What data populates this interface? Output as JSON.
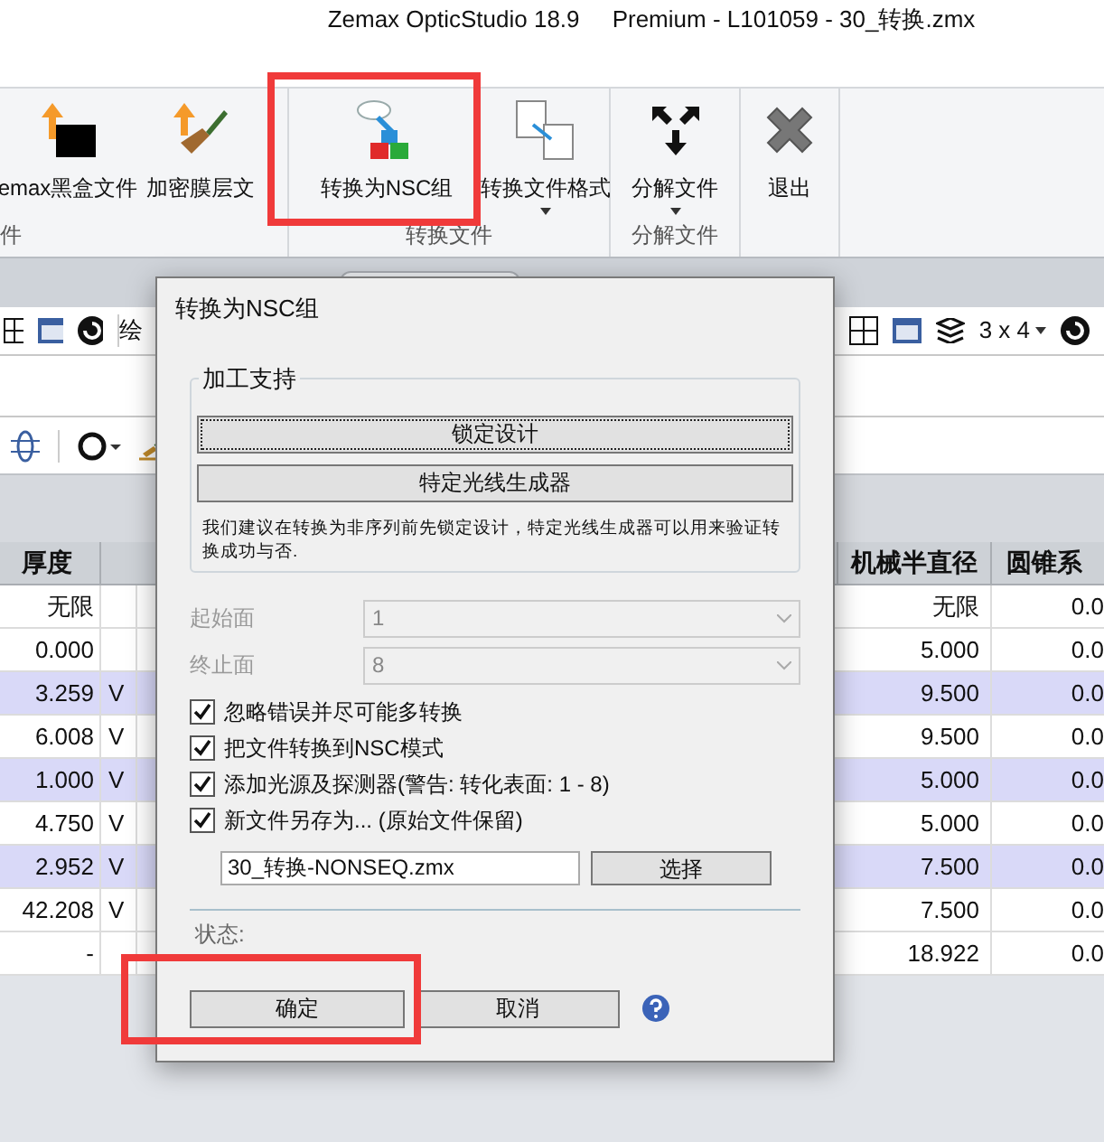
{
  "window": {
    "title": "Zemax OpticStudio 18.9     Premium - L101059 - 30_转换.zmx"
  },
  "ribbon": {
    "groups": [
      {
        "label": "件",
        "buttons": [
          {
            "kind": "blackbox",
            "label": "emax黑盒文件",
            "dropdown": false
          },
          {
            "kind": "coating",
            "label": "加密膜层文",
            "dropdown": false
          }
        ]
      },
      {
        "label": "转换文件",
        "buttons": [
          {
            "kind": "nsc",
            "label": "转换为NSC组",
            "dropdown": false
          },
          {
            "kind": "format",
            "label": "转换文件格式",
            "dropdown": true
          }
        ]
      },
      {
        "label": "分解文件",
        "buttons": [
          {
            "kind": "split",
            "label": "分解文件",
            "dropdown": true
          }
        ]
      },
      {
        "buttons": [
          {
            "kind": "exit",
            "label": "退出",
            "dropdown": false
          }
        ]
      }
    ]
  },
  "toolbar": {
    "left_label": "绘",
    "layout": "3 x 4"
  },
  "table": {
    "columns": [
      "厚度",
      "机械半直径",
      "圆锥系"
    ],
    "rows": [
      {
        "thickness": "无限",
        "solve": "",
        "semi_diameter": "无限",
        "conic": "0.0",
        "highlighted": false
      },
      {
        "thickness": "0.000",
        "solve": "",
        "semi_diameter": "5.000",
        "conic": "0.0",
        "highlighted": false
      },
      {
        "thickness": "3.259",
        "solve": "V",
        "semi_diameter": "9.500",
        "conic": "0.0",
        "highlighted": true
      },
      {
        "thickness": "6.008",
        "solve": "V",
        "semi_diameter": "9.500",
        "conic": "0.0",
        "highlighted": false
      },
      {
        "thickness": "1.000",
        "solve": "V",
        "semi_diameter": "5.000",
        "conic": "0.0",
        "highlighted": true
      },
      {
        "thickness": "4.750",
        "solve": "V",
        "semi_diameter": "5.000",
        "conic": "0.0",
        "highlighted": false
      },
      {
        "thickness": "2.952",
        "solve": "V",
        "semi_diameter": "7.500",
        "conic": "0.0",
        "highlighted": true
      },
      {
        "thickness": "42.208",
        "solve": "V",
        "semi_diameter": "7.500",
        "conic": "0.0",
        "highlighted": false
      },
      {
        "thickness": "-",
        "solve": "",
        "semi_diameter": "18.922",
        "conic": "0.0",
        "highlighted": false
      }
    ]
  },
  "dialog": {
    "title": "转换为NSC组",
    "group_title": "加工支持",
    "support_buttons": [
      {
        "label": "锁定设计",
        "focused": true
      },
      {
        "label": "特定光线生成器",
        "focused": false
      }
    ],
    "note": "我们建议在转换为非序列前先锁定设计，特定光线生成器可以用来验证转换成功与否.",
    "selects": [
      {
        "label": "起始面",
        "value": "1",
        "disabled": true
      },
      {
        "label": "终止面",
        "value": "8",
        "disabled": true
      }
    ],
    "options": [
      {
        "label": "忽略错误并尽可能多转换",
        "checked": true
      },
      {
        "label": "把文件转换到NSC模式",
        "checked": true
      },
      {
        "label": "添加光源及探测器(警告: 转化表面: 1 - 8)",
        "checked": true
      },
      {
        "label": "新文件另存为... (原始文件保留)",
        "checked": true
      }
    ],
    "filename": "30_转换-NONSEQ.zmx",
    "browse": "选择",
    "status_label": "状态:",
    "ok": "确定",
    "cancel": "取消"
  }
}
